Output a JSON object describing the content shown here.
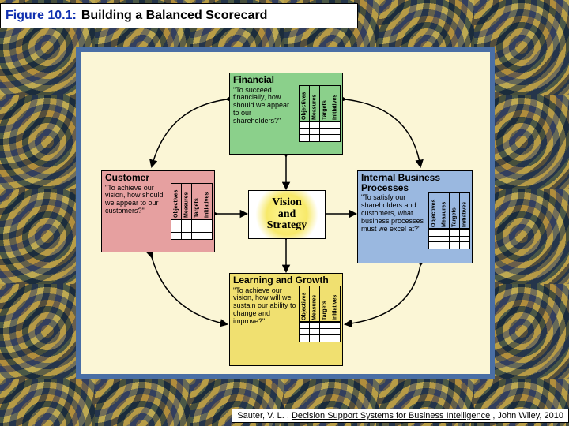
{
  "figure": {
    "label": "Figure 10.1",
    "separator": ":",
    "title": "Building a Balanced Scorecard"
  },
  "center": {
    "line1": "Vision",
    "line2": "and",
    "line3": "Strategy"
  },
  "grid_labels": [
    "Objectives",
    "Measures",
    "Targets",
    "Initiatives"
  ],
  "perspectives": {
    "financial": {
      "title": "Financial",
      "quote": "\"To succeed financially, how should we appear to our shareholders?\""
    },
    "customer": {
      "title": "Customer",
      "quote": "\"To achieve our vision, how should we appear to our customers?\""
    },
    "internal": {
      "title": "Internal Business Processes",
      "quote": "\"To satisfy our shareholders and customers, what business processes must we excel at?\""
    },
    "learning": {
      "title": "Learning and Growth",
      "quote": "\"To achieve our vision, how will we sustain our ability to change and improve?\""
    }
  },
  "citation": {
    "author": "Sauter, V. L. ,",
    "source": "Decision Support Systems for Business Intelligence",
    "publisher": ", John Wiley, 2010"
  }
}
